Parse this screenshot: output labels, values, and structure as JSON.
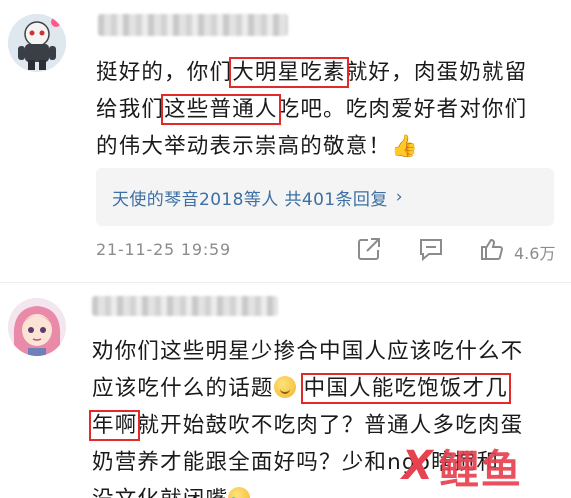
{
  "comment1": {
    "username": "",
    "lines": [
      [
        "挺好的，你们",
        {
          "hl": "大明星吃素"
        },
        "就好，肉蛋奶就留"
      ],
      [
        "给我们",
        {
          "hl": "这些普通人"
        },
        "吃吧。吃肉爱好者对你们"
      ],
      [
        "的伟大举动表示崇高的敬意！👍"
      ]
    ],
    "replies_label": "天使的琴音2018等人  共401条回复",
    "replies_chevron": "›",
    "timestamp": "21-11-25 19:59",
    "like_count": "4.6万",
    "icons": [
      "share-icon",
      "comment-icon",
      "like-icon"
    ]
  },
  "comment2": {
    "username": "",
    "line1": "劝你们这些明星少掺合中国人应该吃什么不",
    "line2_a": "应该吃什么的话题",
    "line2_hl": "中国人能吃饱饭才几",
    "line3_hl": "年啊",
    "line3_b": "就开始鼓吹不吃肉了？普通人多吃肉蛋",
    "line4": "奶营养才能跟全面好吗？少和ngo瞎搅和",
    "line5": "没文化就闭嘴",
    "emojis": [
      "smile-emoji",
      "cry-emoji"
    ]
  },
  "watermark": {
    "mark": "X",
    "text": "鲤鱼"
  },
  "colors": {
    "highlight": "#e22a2a",
    "link": "#3c6fa3",
    "meta": "#8c8c8c",
    "watermark": "#e8414f"
  }
}
